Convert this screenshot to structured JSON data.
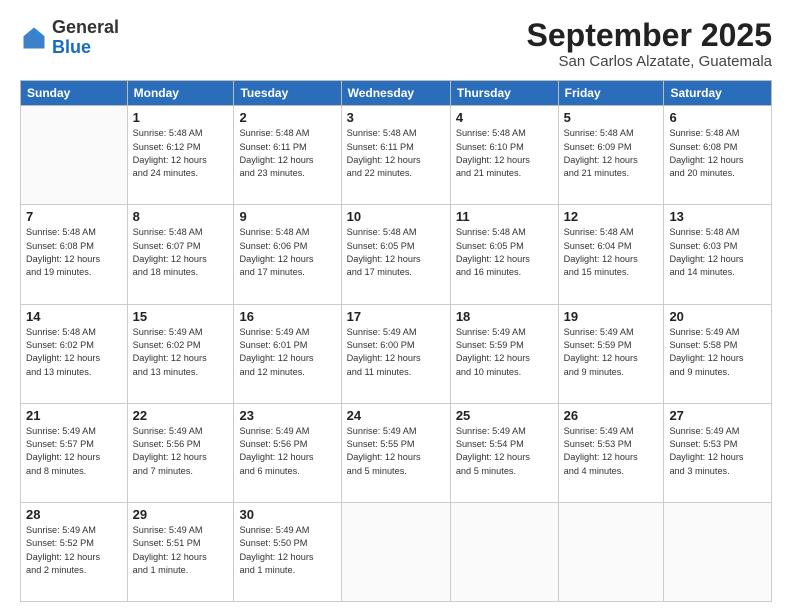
{
  "header": {
    "logo_line1": "General",
    "logo_line2": "Blue",
    "month": "September 2025",
    "location": "San Carlos Alzatate, Guatemala"
  },
  "weekdays": [
    "Sunday",
    "Monday",
    "Tuesday",
    "Wednesday",
    "Thursday",
    "Friday",
    "Saturday"
  ],
  "weeks": [
    [
      {
        "day": "",
        "info": ""
      },
      {
        "day": "1",
        "info": "Sunrise: 5:48 AM\nSunset: 6:12 PM\nDaylight: 12 hours\nand 24 minutes."
      },
      {
        "day": "2",
        "info": "Sunrise: 5:48 AM\nSunset: 6:11 PM\nDaylight: 12 hours\nand 23 minutes."
      },
      {
        "day": "3",
        "info": "Sunrise: 5:48 AM\nSunset: 6:11 PM\nDaylight: 12 hours\nand 22 minutes."
      },
      {
        "day": "4",
        "info": "Sunrise: 5:48 AM\nSunset: 6:10 PM\nDaylight: 12 hours\nand 21 minutes."
      },
      {
        "day": "5",
        "info": "Sunrise: 5:48 AM\nSunset: 6:09 PM\nDaylight: 12 hours\nand 21 minutes."
      },
      {
        "day": "6",
        "info": "Sunrise: 5:48 AM\nSunset: 6:08 PM\nDaylight: 12 hours\nand 20 minutes."
      }
    ],
    [
      {
        "day": "7",
        "info": "Sunrise: 5:48 AM\nSunset: 6:08 PM\nDaylight: 12 hours\nand 19 minutes."
      },
      {
        "day": "8",
        "info": "Sunrise: 5:48 AM\nSunset: 6:07 PM\nDaylight: 12 hours\nand 18 minutes."
      },
      {
        "day": "9",
        "info": "Sunrise: 5:48 AM\nSunset: 6:06 PM\nDaylight: 12 hours\nand 17 minutes."
      },
      {
        "day": "10",
        "info": "Sunrise: 5:48 AM\nSunset: 6:05 PM\nDaylight: 12 hours\nand 17 minutes."
      },
      {
        "day": "11",
        "info": "Sunrise: 5:48 AM\nSunset: 6:05 PM\nDaylight: 12 hours\nand 16 minutes."
      },
      {
        "day": "12",
        "info": "Sunrise: 5:48 AM\nSunset: 6:04 PM\nDaylight: 12 hours\nand 15 minutes."
      },
      {
        "day": "13",
        "info": "Sunrise: 5:48 AM\nSunset: 6:03 PM\nDaylight: 12 hours\nand 14 minutes."
      }
    ],
    [
      {
        "day": "14",
        "info": "Sunrise: 5:48 AM\nSunset: 6:02 PM\nDaylight: 12 hours\nand 13 minutes."
      },
      {
        "day": "15",
        "info": "Sunrise: 5:49 AM\nSunset: 6:02 PM\nDaylight: 12 hours\nand 13 minutes."
      },
      {
        "day": "16",
        "info": "Sunrise: 5:49 AM\nSunset: 6:01 PM\nDaylight: 12 hours\nand 12 minutes."
      },
      {
        "day": "17",
        "info": "Sunrise: 5:49 AM\nSunset: 6:00 PM\nDaylight: 12 hours\nand 11 minutes."
      },
      {
        "day": "18",
        "info": "Sunrise: 5:49 AM\nSunset: 5:59 PM\nDaylight: 12 hours\nand 10 minutes."
      },
      {
        "day": "19",
        "info": "Sunrise: 5:49 AM\nSunset: 5:59 PM\nDaylight: 12 hours\nand 9 minutes."
      },
      {
        "day": "20",
        "info": "Sunrise: 5:49 AM\nSunset: 5:58 PM\nDaylight: 12 hours\nand 9 minutes."
      }
    ],
    [
      {
        "day": "21",
        "info": "Sunrise: 5:49 AM\nSunset: 5:57 PM\nDaylight: 12 hours\nand 8 minutes."
      },
      {
        "day": "22",
        "info": "Sunrise: 5:49 AM\nSunset: 5:56 PM\nDaylight: 12 hours\nand 7 minutes."
      },
      {
        "day": "23",
        "info": "Sunrise: 5:49 AM\nSunset: 5:56 PM\nDaylight: 12 hours\nand 6 minutes."
      },
      {
        "day": "24",
        "info": "Sunrise: 5:49 AM\nSunset: 5:55 PM\nDaylight: 12 hours\nand 5 minutes."
      },
      {
        "day": "25",
        "info": "Sunrise: 5:49 AM\nSunset: 5:54 PM\nDaylight: 12 hours\nand 5 minutes."
      },
      {
        "day": "26",
        "info": "Sunrise: 5:49 AM\nSunset: 5:53 PM\nDaylight: 12 hours\nand 4 minutes."
      },
      {
        "day": "27",
        "info": "Sunrise: 5:49 AM\nSunset: 5:53 PM\nDaylight: 12 hours\nand 3 minutes."
      }
    ],
    [
      {
        "day": "28",
        "info": "Sunrise: 5:49 AM\nSunset: 5:52 PM\nDaylight: 12 hours\nand 2 minutes."
      },
      {
        "day": "29",
        "info": "Sunrise: 5:49 AM\nSunset: 5:51 PM\nDaylight: 12 hours\nand 1 minute."
      },
      {
        "day": "30",
        "info": "Sunrise: 5:49 AM\nSunset: 5:50 PM\nDaylight: 12 hours\nand 1 minute."
      },
      {
        "day": "",
        "info": ""
      },
      {
        "day": "",
        "info": ""
      },
      {
        "day": "",
        "info": ""
      },
      {
        "day": "",
        "info": ""
      }
    ]
  ]
}
